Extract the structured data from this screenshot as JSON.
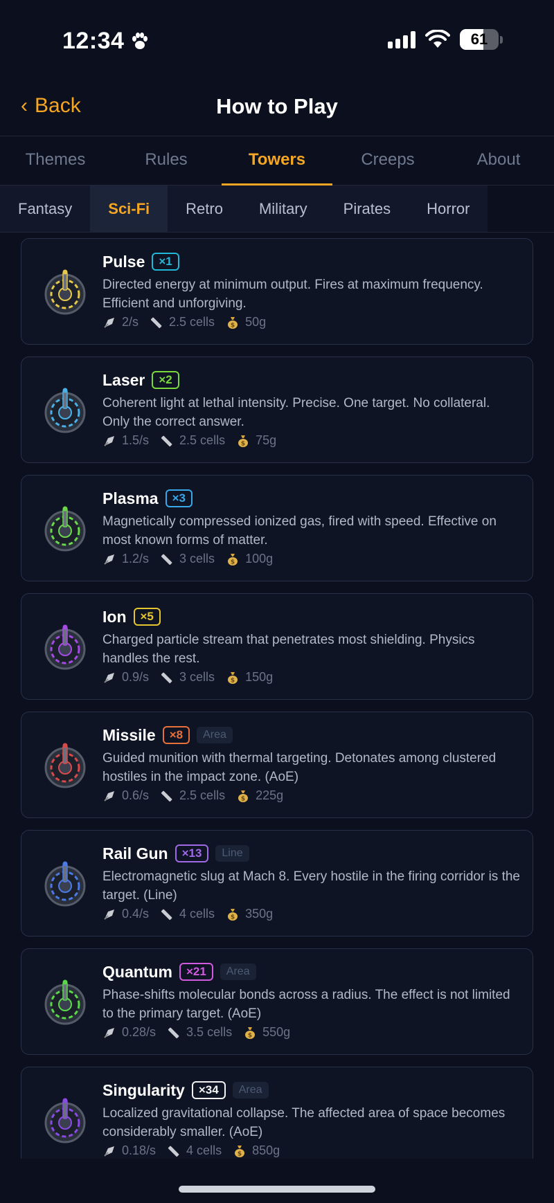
{
  "status": {
    "time": "12:34",
    "battery": "61"
  },
  "nav": {
    "back_label": "Back",
    "title": "How to Play"
  },
  "tabs": [
    {
      "label": "Themes"
    },
    {
      "label": "Rules"
    },
    {
      "label": "Towers"
    },
    {
      "label": "Creeps"
    },
    {
      "label": "About"
    }
  ],
  "active_tab": "Towers",
  "subtabs": [
    {
      "label": "Fantasy"
    },
    {
      "label": "Sci-Fi"
    },
    {
      "label": "Retro"
    },
    {
      "label": "Military"
    },
    {
      "label": "Pirates"
    },
    {
      "label": "Horror"
    }
  ],
  "active_subtab": "Sci-Fi",
  "towers": [
    {
      "name": "Pulse",
      "mult": "×1",
      "mult_color": "#22b8d8",
      "tag": "",
      "desc": "Directed energy at minimum output. Fires at maximum frequency. Efficient and unforgiving.",
      "rate": "2/s",
      "range": "2.5 cells",
      "cost": "50g",
      "icon": "pulse-tower-icon",
      "accent": "#e6c84a"
    },
    {
      "name": "Laser",
      "mult": "×2",
      "mult_color": "#7ad83a",
      "tag": "",
      "desc": "Coherent light at lethal intensity. Precise. One target. No collateral. Only the correct answer.",
      "rate": "1.5/s",
      "range": "2.5 cells",
      "cost": "75g",
      "icon": "laser-tower-icon",
      "accent": "#4ab0e6"
    },
    {
      "name": "Plasma",
      "mult": "×3",
      "mult_color": "#3aa8e8",
      "tag": "",
      "desc": "Magnetically compressed ionized gas, fired with speed. Effective on most known forms of matter.",
      "rate": "1.2/s",
      "range": "3 cells",
      "cost": "100g",
      "icon": "plasma-tower-icon",
      "accent": "#6ad84a"
    },
    {
      "name": "Ion",
      "mult": "×5",
      "mult_color": "#e6c62e",
      "tag": "",
      "desc": "Charged particle stream that penetrates most shielding. Physics handles the rest.",
      "rate": "0.9/s",
      "range": "3 cells",
      "cost": "150g",
      "icon": "ion-tower-icon",
      "accent": "#a64ae6"
    },
    {
      "name": "Missile",
      "mult": "×8",
      "mult_color": "#e8703a",
      "tag": "Area",
      "desc": "Guided munition with thermal targeting. Detonates among clustered hostiles in the impact zone. (AoE)",
      "rate": "0.6/s",
      "range": "2.5 cells",
      "cost": "225g",
      "icon": "missile-tower-icon",
      "accent": "#d84a4a"
    },
    {
      "name": "Rail Gun",
      "mult": "×13",
      "mult_color": "#a06ae6",
      "tag": "Line",
      "desc": "Electromagnetic slug at Mach 8. Every hostile in the firing corridor is the target. (Line)",
      "rate": "0.4/s",
      "range": "4 cells",
      "cost": "350g",
      "icon": "railgun-tower-icon",
      "accent": "#4a7ae6"
    },
    {
      "name": "Quantum",
      "mult": "×21",
      "mult_color": "#d25ae0",
      "tag": "Area",
      "desc": "Phase-shifts molecular bonds across a radius. The effect is not limited to the primary target. (AoE)",
      "rate": "0.28/s",
      "range": "3.5 cells",
      "cost": "550g",
      "icon": "quantum-tower-icon",
      "accent": "#5ad84a"
    },
    {
      "name": "Singularity",
      "mult": "×34",
      "mult_color": "#f2f2f2",
      "tag": "Area",
      "desc": "Localized gravitational collapse. The affected area of space becomes considerably smaller. (AoE)",
      "rate": "0.18/s",
      "range": "4 cells",
      "cost": "850g",
      "icon": "singularity-tower-icon",
      "accent": "#8a4ae6"
    }
  ]
}
